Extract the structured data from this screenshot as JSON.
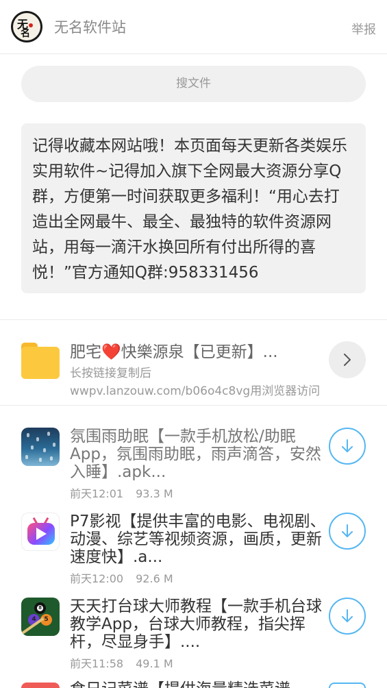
{
  "header": {
    "logo_text_1": "无",
    "logo_text_2": "名",
    "site_title": "无名软件站",
    "report_label": "举报"
  },
  "search": {
    "placeholder": "搜文件"
  },
  "notice": {
    "text": "记得收藏本网站哦！本页面每天更新各类娱乐实用软件~记得加入旗下全网最大资源分享Q群，方便第一时间获取更多福利！“用心去打造出全网最牛、最全、最独特的软件资源网站，用每一滴汗水换回所有付出所得的喜悦！”官方通知Q群:958331456"
  },
  "folder": {
    "title_part1": "肥宅",
    "heart": "❤️",
    "title_part2": "快樂源泉【已更新】...",
    "subtitle": "长按链接复制后",
    "url_hint": "wwpv.lanzouw.com/b06o4c8vg用浏览器访问",
    "icon": "folder-icon",
    "action_icon": "chevron-right-icon"
  },
  "files": [
    {
      "title": "氛围雨助眠【一款手机放松/助眠App，氛围雨助眠，雨声滴答，安然入睡】.apk...",
      "time": "前天12:01",
      "size": "93.3 M",
      "icon": "rain-app-icon"
    },
    {
      "title": "P7影视【提供丰富的电影、电视剧、动漫、综艺等视频资源，画质，更新速度快】.a...",
      "time": "前天12:00",
      "size": "92.6 M",
      "icon": "p7-video-app-icon"
    },
    {
      "title": "天天打台球大师教程【一款手机台球教学App，台球大师教程，指尖挥杆，尽显身手】....",
      "time": "前天11:58",
      "size": "49.1 M",
      "icon": "billiards-app-icon"
    },
    {
      "title": "食日记菜谱【提供海量精选菜谱",
      "time": "",
      "size": "",
      "icon": "recipe-app-icon"
    }
  ],
  "colors": {
    "accent_blue": "#54b6f2",
    "folder_yellow": "#fcc93e",
    "heart_red": "#d9233b"
  }
}
